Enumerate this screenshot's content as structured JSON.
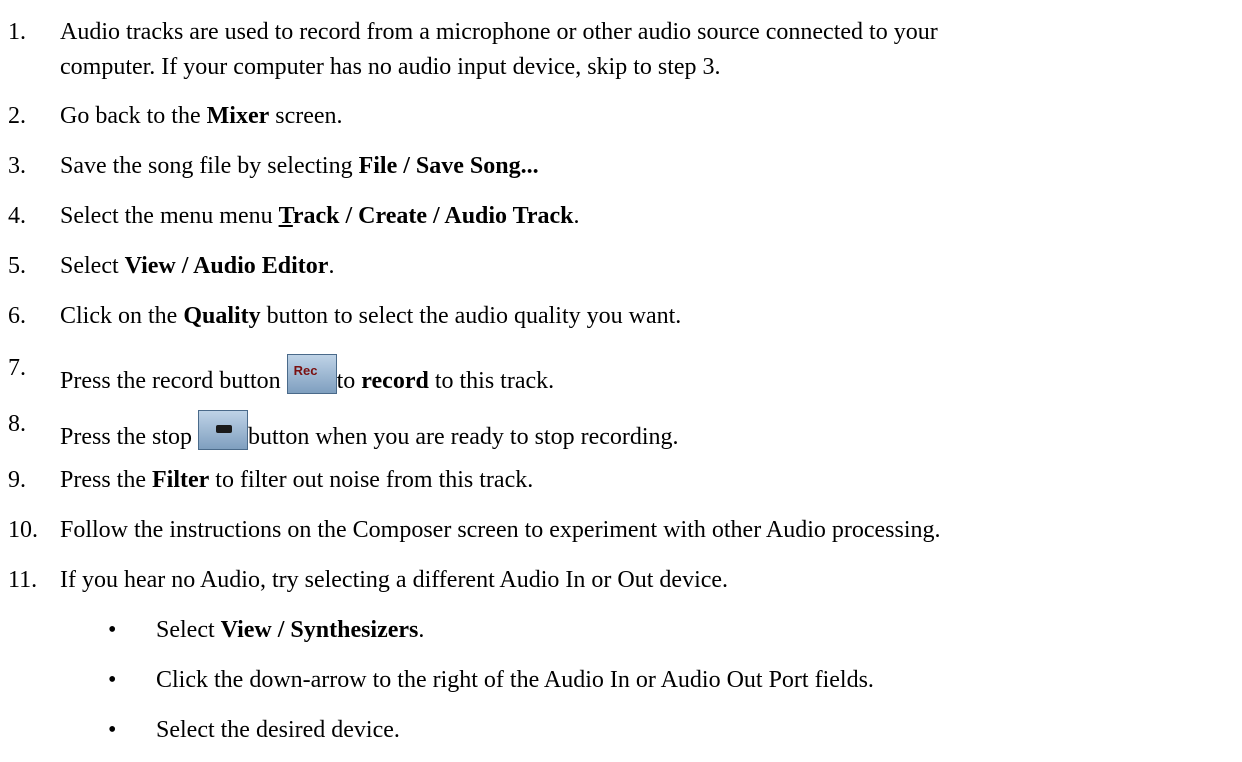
{
  "steps": [
    {
      "num": "1.",
      "line1": "Audio tracks are used to record from a microphone or other audio source connected to your",
      "line2": "computer. If your computer has no audio input device, skip to step 3."
    },
    {
      "num": "2.",
      "pre": "Go back to the ",
      "bold": "Mixer",
      "post": " screen."
    },
    {
      "num": "3.",
      "pre": "Save the song file by selecting ",
      "bold": "File / Save Song..."
    },
    {
      "num": "4.",
      "pre": "Select the menu menu ",
      "bold_u": "T",
      "bold": "rack / Create / Audio Track",
      "post": "."
    },
    {
      "num": "5.",
      "pre": "Select ",
      "bold": "View / Audio Editor",
      "post": "."
    },
    {
      "num": "6.",
      "pre": "Click on the ",
      "bold": "Quality",
      "post": " button to select the audio quality you want."
    },
    {
      "num": "7.",
      "pre": "Press the record button ",
      "icon_label": "Rec",
      "mid": "to ",
      "bold": "record",
      "post": " to this track."
    },
    {
      "num": "8.",
      "pre": "Press the stop ",
      "post": "button when you are ready to stop recording."
    },
    {
      "num": "9.",
      "pre": "Press the ",
      "bold": "Filter",
      "post": " to filter out noise from this track."
    },
    {
      "num": "10.",
      "text": "Follow the instructions on the Composer screen to experiment with other Audio processing."
    },
    {
      "num": "11.",
      "text": "If you hear no Audio, try selecting a different Audio In or Out device."
    }
  ],
  "bullet_char": "•",
  "subitems": [
    {
      "pre": "Select ",
      "bold": "View / Synthesizers",
      "post": "."
    },
    {
      "text": "Click the down-arrow to the right of the Audio In or Audio Out Port fields."
    },
    {
      "text": "Select the desired device."
    }
  ]
}
